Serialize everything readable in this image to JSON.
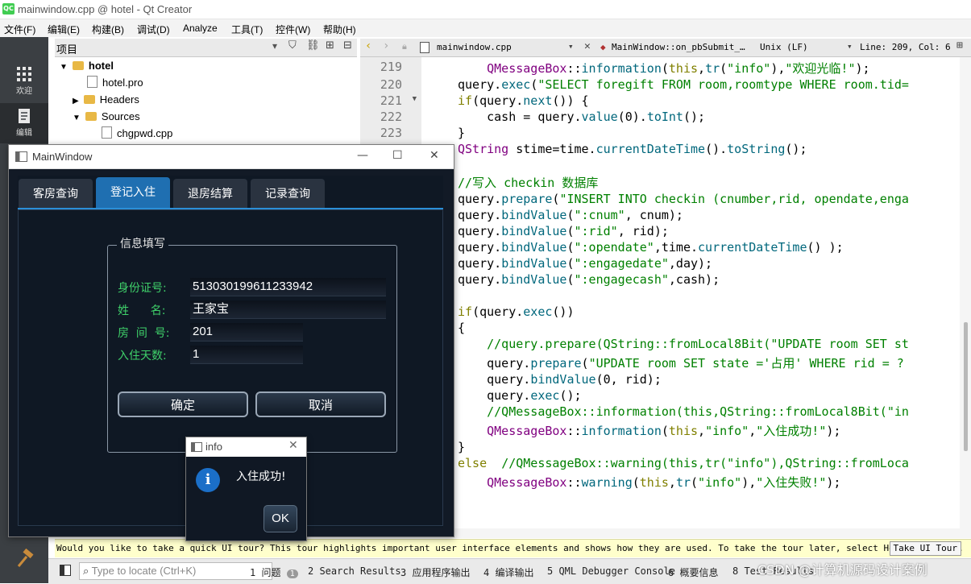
{
  "window": {
    "title": "mainwindow.cpp @ hotel - Qt Creator",
    "logo": "QC"
  },
  "menu": [
    "文件(F)",
    "编辑(E)",
    "构建(B)",
    "调试(D)",
    "Analyze",
    "工具(T)",
    "控件(W)",
    "帮助(H)"
  ],
  "modes": {
    "welcome": "欢迎",
    "edit": "编辑"
  },
  "project": {
    "header": "项目",
    "tree": [
      {
        "label": "hotel",
        "kind": "root"
      },
      {
        "label": "hotel.pro",
        "kind": "file"
      },
      {
        "label": "Headers",
        "kind": "folder"
      },
      {
        "label": "Sources",
        "kind": "folder"
      },
      {
        "label": "chgpwd.cpp",
        "kind": "file"
      }
    ]
  },
  "editor": {
    "file": "mainwindow.cpp",
    "symbol": "MainWindow::on_pbSubmit_…",
    "encoding": "Unix (LF)",
    "position": "Line: 209, Col: 6",
    "line_numbers": [
      "219",
      "220",
      "221",
      "222",
      "223"
    ]
  },
  "tour": {
    "message": "Would you like to take a quick UI tour? This tour highlights important user interface elements and shows how they are used. To take the tour later, select Help > UI Tour.",
    "button": "Take UI Tour"
  },
  "output": {
    "locate_placeholder": "Type to locate (Ctrl+K)",
    "tabs": [
      "1 问题",
      "2 Search Results",
      "3 应用程序输出",
      "4 编译输出",
      "5 QML Debugger Console",
      "6 概要信息",
      "8 Test Results"
    ],
    "issues_count": "1"
  },
  "mainwindow": {
    "title": "MainWindow",
    "tabs": [
      "客房查询",
      "登记入住",
      "退房结算",
      "记录查询"
    ],
    "active_tab": 1,
    "group_title": "信息填写",
    "fields": {
      "id_label": "身份证号:",
      "id_value": "513030199611233942",
      "name_label": "姓      名:",
      "name_value": "王家宝",
      "room_label": "房  间  号:",
      "room_value": "201",
      "days_label": "入住天数:",
      "days_value": "1"
    },
    "confirm": "确定",
    "cancel": "取消"
  },
  "infobox": {
    "title": "info",
    "message": "入住成功!",
    "ok": "OK",
    "icon": "i"
  },
  "watermark": "CSDN @计算机源码设计案例",
  "colors": {
    "accent_tab": "#1f6fb1",
    "label_green": "#3fd16a",
    "dialog_bg": "#0f1824"
  }
}
